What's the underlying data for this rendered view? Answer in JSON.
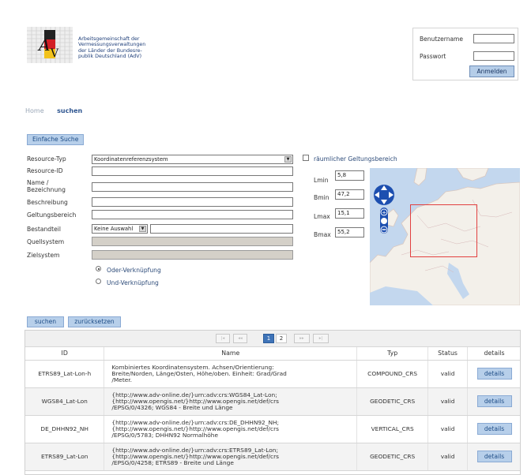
{
  "header": {
    "org_lines": [
      "Arbeitsgemeinschaft der",
      "Vermessungsverwaltungen",
      "der Länder der Bundesre-",
      "publik Deutschland (AdV)"
    ],
    "login": {
      "username_label": "Benutzername",
      "username_value": "",
      "password_label": "Passwort",
      "password_value": "",
      "submit_label": "Anmelden"
    }
  },
  "breadcrumb": {
    "home": "Home",
    "current": "suchen"
  },
  "tabs": {
    "simple_search": "Einfache Suche"
  },
  "form": {
    "resource_type_label": "Resource-Typ",
    "resource_type_value": "Koordinatenreferenzsystem",
    "resource_id_label": "Resource-ID",
    "name_label_line1": "Name /",
    "name_label_line2": "Bezeichnung",
    "description_label": "Beschreibung",
    "scope_label": "Geltungsbereich",
    "component_label": "Bestandteil",
    "component_select": "Keine Auswahl",
    "source_system_label": "Quellsystem",
    "target_system_label": "Zielsystem",
    "or_label": "Oder-Verknüpfung",
    "and_label": "Und-Verknüpfung"
  },
  "spatial": {
    "checkbox_label": "räumlicher Geltungsbereich",
    "lmin_label": "Lmin",
    "lmin": "5,8",
    "bmin_label": "Bmin",
    "bmin": "47,2",
    "lmax_label": "Lmax",
    "lmax": "15,1",
    "bmax_label": "Bmax",
    "bmax": "55,2"
  },
  "actions": {
    "search": "suchen",
    "reset": "zurücksetzen"
  },
  "pager": {
    "first": "|◂",
    "prev": "◂◂",
    "pages": [
      "1",
      "2"
    ],
    "next": "▸▸",
    "last": "▸|"
  },
  "results": {
    "columns": [
      "ID",
      "Name",
      "Typ",
      "Status",
      "details"
    ],
    "rows": [
      {
        "id": "ETRS89_Lat-Lon-h",
        "name_lines": [
          "Kombiniertes Koordinatensystem. Achsen/Orientierung:",
          "Breite/Norden, Länge/Osten, Höhe/oben. Einheit: Grad/Grad",
          "/Meter."
        ],
        "type": "COMPOUND_CRS",
        "status": "valid",
        "details": "details"
      },
      {
        "id": "WGS84_Lat-Lon",
        "name_lines": [
          "{http://www.adv-online.de/}urn:adv:crs:WGS84_Lat-Lon;",
          "{http://www.opengis.net/}http://www.opengis.net/def/crs",
          "/EPSG/0/4326; WGS84 - Breite und Länge"
        ],
        "type": "GEODETIC_CRS",
        "status": "valid",
        "details": "details"
      },
      {
        "id": "DE_DHHN92_NH",
        "name_lines": [
          "{http://www.adv-online.de/}urn:adv:crs:DE_DHHN92_NH;",
          "{http://www.opengis.net/}http://www.opengis.net/def/crs",
          "/EPSG/0/5783; DHHN92 Normalhöhe"
        ],
        "type": "VERTICAL_CRS",
        "status": "valid",
        "details": "details"
      },
      {
        "id": "ETRS89_Lat-Lon",
        "name_lines": [
          "{http://www.adv-online.de/}urn:adv:crs:ETRS89_Lat-Lon;",
          "{http://www.opengis.net/}http://www.opengis.net/def/crs",
          "/EPSG/0/4258; ETRS89 - Breite und Länge"
        ],
        "type": "GEODETIC_CRS",
        "status": "valid",
        "details": "details"
      }
    ]
  }
}
